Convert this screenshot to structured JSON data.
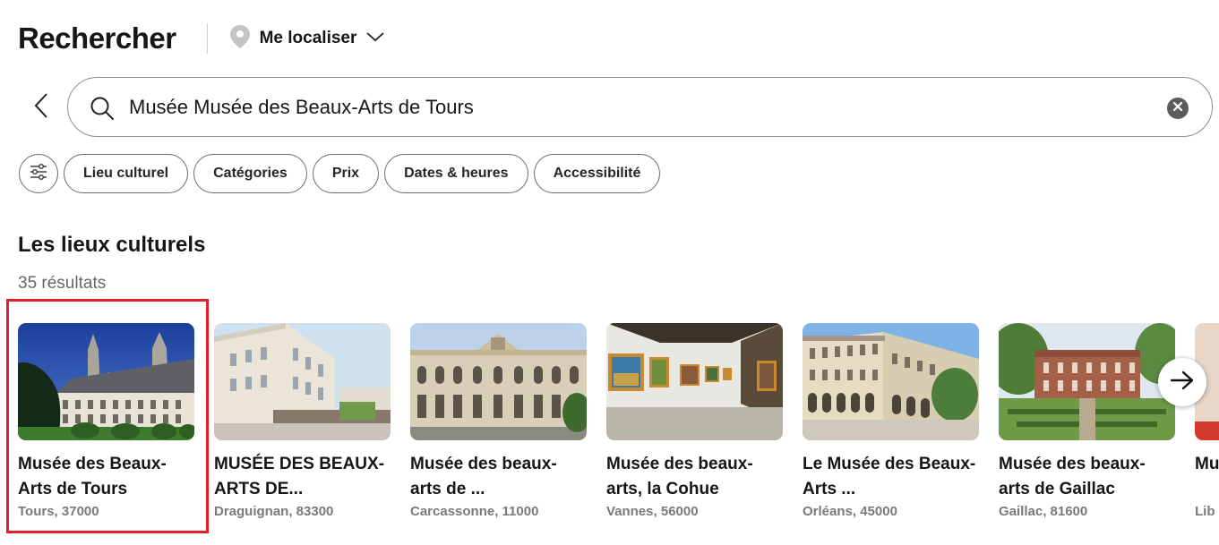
{
  "header": {
    "title": "Rechercher",
    "locate_label": "Me localiser",
    "locate_icon": "location-pin-icon"
  },
  "search": {
    "value": "Musée Musée des Beaux-Arts de Tours",
    "icon": "search-icon",
    "clear_icon": "clear-icon"
  },
  "filters": {
    "icon": "sliders-icon",
    "chips": [
      "Lieu culturel",
      "Catégories",
      "Prix",
      "Dates & heures",
      "Accessibilité"
    ]
  },
  "section": {
    "title": "Les lieux culturels",
    "count": "35 résultats"
  },
  "cards": [
    {
      "title": "Musée des Beaux-Arts de Tours",
      "subtitle": "Tours, 37000",
      "selected": true
    },
    {
      "title": "MUSÉE DES BEAUX-ARTS DE...",
      "subtitle": "Draguignan, 83300"
    },
    {
      "title": "Musée des beaux-arts de ...",
      "subtitle": "Carcassonne, 11000"
    },
    {
      "title": "Musée des beaux-arts, la Cohue",
      "subtitle": "Vannes, 56000"
    },
    {
      "title": "Le Musée des Beaux-Arts ...",
      "subtitle": "Orléans, 45000"
    },
    {
      "title": "Musée des beaux-arts de Gaillac",
      "subtitle": "Gaillac, 81600"
    },
    {
      "title": "Mu Ar",
      "subtitle": "Lib"
    }
  ],
  "colors": {
    "selected_outline": "#e0202a",
    "text": "#161616",
    "muted": "#7a7a7a"
  }
}
